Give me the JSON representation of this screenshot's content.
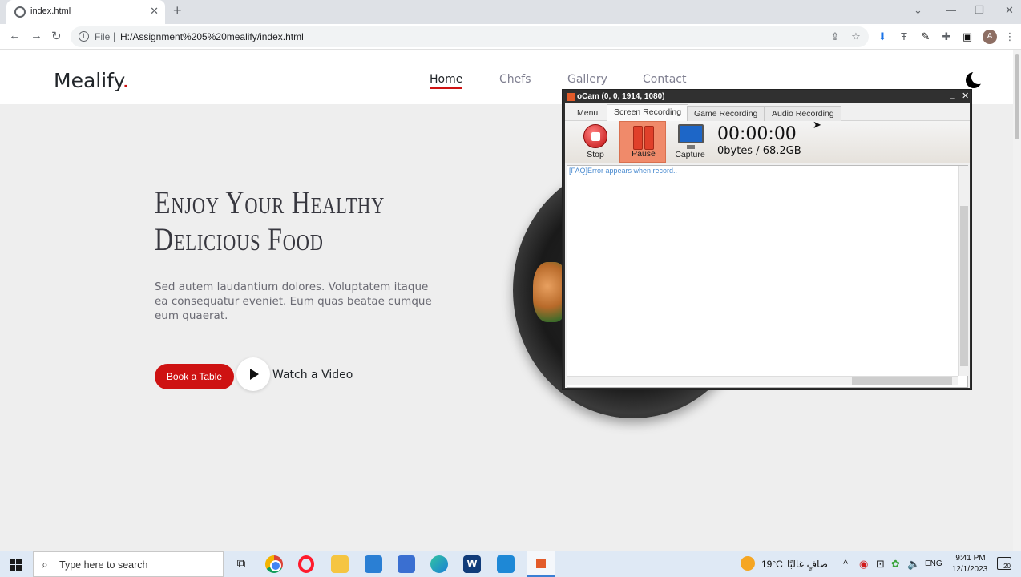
{
  "browser": {
    "tab_title": "index.html",
    "tab_close": "✕",
    "new_tab": "+",
    "scheme": "File",
    "url": "H:/Assignment%205%20mealify/index.html",
    "profile_initial": "A"
  },
  "site": {
    "logo": "Mealify",
    "logo_dot": ".",
    "nav": [
      "Home",
      "Chefs",
      "Gallery",
      "Contact"
    ],
    "hero_title_line1": "Enjoy Your Healthy",
    "hero_title_line2": "Delicious Food",
    "hero_text": "Sed autem laudantium dolores. Voluptatem itaque ea consequatur eveniet. Eum quas beatae cumque eum quaerat.",
    "book_button": "Book a Table",
    "watch_video": "Watch a Video",
    "colors": {
      "accent": "#ce1212",
      "background": "#eeeeee"
    }
  },
  "ocam": {
    "title": "oCam (0, 0, 1914, 1080)",
    "tabs": [
      "Menu",
      "Screen Recording",
      "Game Recording",
      "Audio Recording"
    ],
    "active_tab": "Screen Recording",
    "buttons": {
      "stop": "Stop",
      "pause": "Pause",
      "capture": "Capture"
    },
    "timer": "00:00:00",
    "storage": "0bytes / 68.2GB",
    "log_link": "[FAQ]Error appears when record.."
  },
  "taskbar": {
    "search_placeholder": "Type here to search",
    "temperature": "19°C",
    "weather": "صافٍ غالبًا",
    "language": "ENG",
    "time": "9:41 PM",
    "date": "12/1/2023",
    "notifications": "20"
  }
}
